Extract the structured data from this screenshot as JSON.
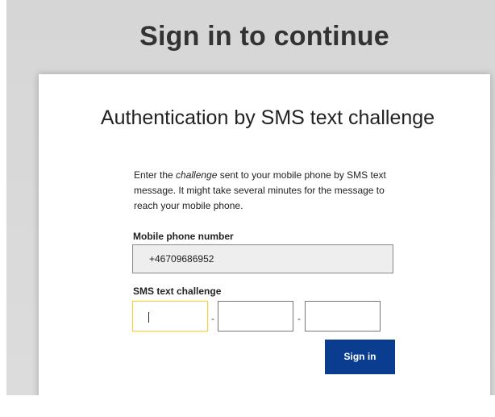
{
  "page": {
    "title": "Sign in to continue"
  },
  "card": {
    "title": "Authentication by SMS text challenge",
    "intro_before": "Enter the ",
    "intro_em": "challenge",
    "intro_after": " sent to your mobile phone by SMS text message. It might take several minutes for the message to reach your mobile phone."
  },
  "phone": {
    "label": "Mobile phone number",
    "value": "+46709686952"
  },
  "challenge": {
    "label": "SMS text challenge",
    "separator": "-",
    "part1": "",
    "part2": "",
    "part3": ""
  },
  "actions": {
    "signin_label": "Sign in"
  },
  "colors": {
    "primary_button": "#0a3d8f",
    "focus_border": "#f3d24a",
    "page_background": "#d6d6d6"
  }
}
